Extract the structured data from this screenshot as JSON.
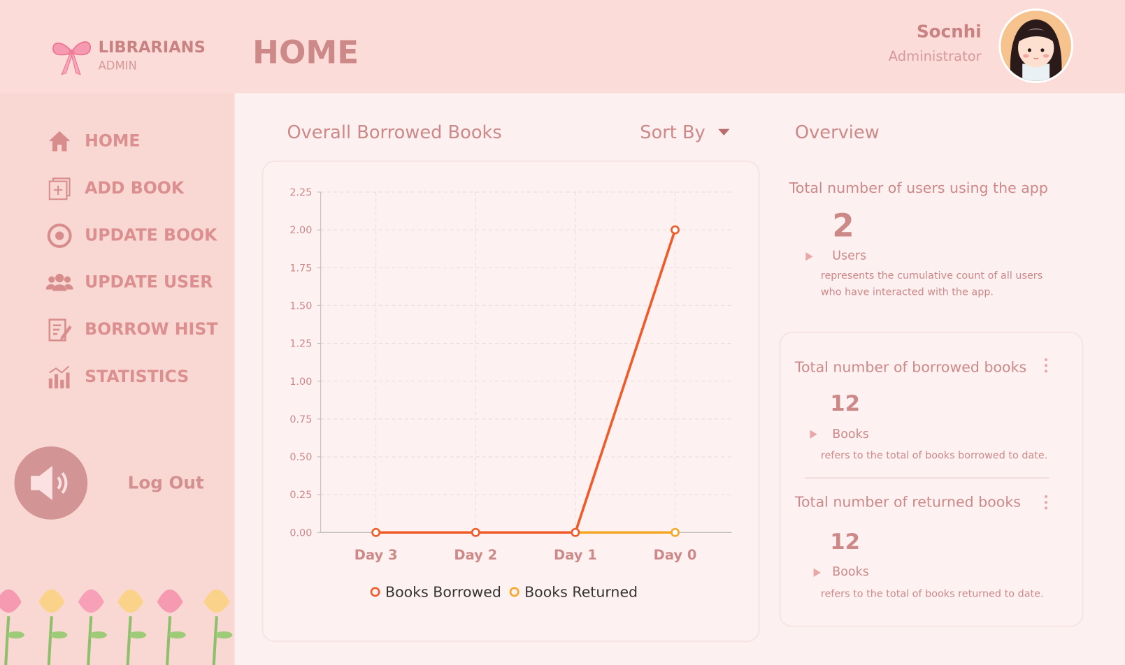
{
  "brand": {
    "title": "LIBRARIANS",
    "subtitle": "ADMIN"
  },
  "header": {
    "title": "HOME",
    "user_name": "Socnhi",
    "user_role": "Administrator"
  },
  "sidebar": {
    "items": [
      {
        "label": "HOME",
        "icon": "home-icon"
      },
      {
        "label": "ADD BOOK",
        "icon": "add-book-icon"
      },
      {
        "label": "UPDATE BOOK",
        "icon": "update-icon"
      },
      {
        "label": "UPDATE USER",
        "icon": "users-icon"
      },
      {
        "label": "BORROW HIST",
        "icon": "history-icon"
      },
      {
        "label": "STATISTICS",
        "icon": "statistics-icon"
      }
    ],
    "logout": "Log Out"
  },
  "chart_panel": {
    "title": "Overall Borrowed Books",
    "sort_label": "Sort By"
  },
  "overview": {
    "title": "Overview",
    "users": {
      "title": "Total number of users using the app",
      "value": "2",
      "unit": "Users",
      "desc1": "represents the cumulative count of all users",
      "desc2": "who have interacted with the app."
    },
    "borrowed": {
      "title": "Total number of borrowed books",
      "value": "12",
      "unit": "Books",
      "desc": "refers to the total of books borrowed to date."
    },
    "returned": {
      "title": "Total number of returned books",
      "value": "12",
      "unit": "Books",
      "desc": "refers to the total of books returned to date."
    }
  },
  "chart_data": {
    "type": "line",
    "title": "",
    "xlabel": "",
    "ylabel": "",
    "categories": [
      "Day 3",
      "Day 2",
      "Day 1",
      "Day 0"
    ],
    "ylim": [
      0,
      2.25
    ],
    "yticks": [
      "0.00",
      "0.25",
      "0.50",
      "0.75",
      "1.00",
      "1.25",
      "1.50",
      "1.75",
      "2.00",
      "2.25"
    ],
    "grid": true,
    "legend": "bottom",
    "series": [
      {
        "name": "Books Borrowed",
        "values": [
          0,
          0,
          0,
          2
        ],
        "color": "#f05a28"
      },
      {
        "name": "Books Returned",
        "values": [
          0,
          0,
          0,
          0
        ],
        "color": "#f5a623"
      }
    ]
  }
}
